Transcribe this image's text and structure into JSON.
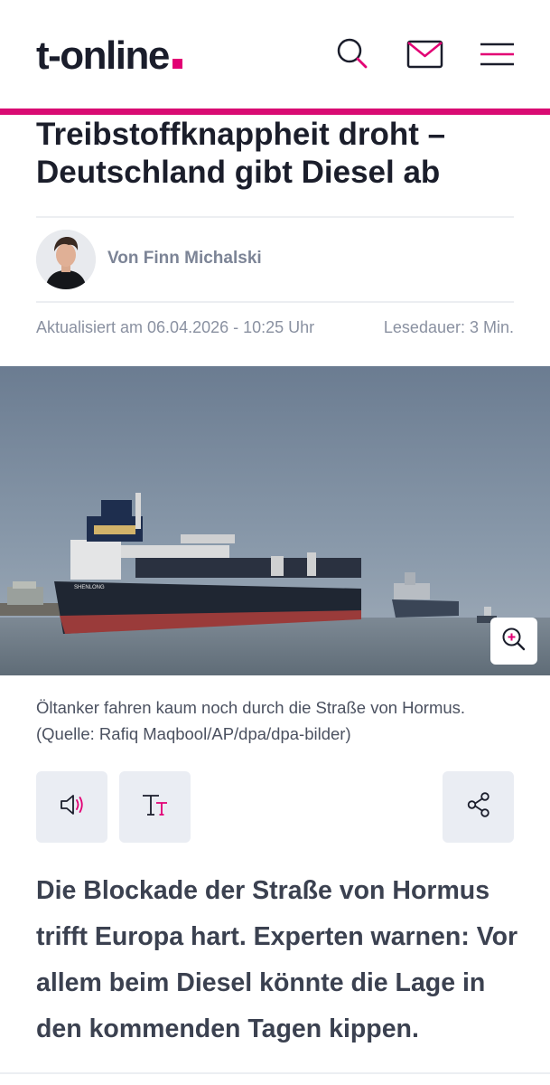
{
  "header": {
    "logo_text": "t-online",
    "accent_color": "#e20074",
    "icons": [
      "search-icon",
      "mail-icon",
      "menu-icon"
    ]
  },
  "article": {
    "title_line1": "Treibstoffknappheit droht –",
    "title_line2": "Deutschland gibt Diesel ab",
    "author": "Von Finn Michalski",
    "updated": "Aktualisiert am 06.04.2026 - 10:25 Uhr",
    "reading_time": "Lesedauer: 3 Min.",
    "image_caption_line1": "Öltanker fahren kaum noch durch die Straße von Hormus.",
    "image_caption_line2": "(Quelle: Rafiq Maqbool/AP/dpa/dpa-bilder)",
    "ship_name": "SHENLONG",
    "lead": "Die Blockade der Straße von Hormus trifft Europa hart. Experten warnen: Vor allem beim Diesel könnte die Lage in den kommenden Tagen kippen."
  },
  "actions": {
    "icons": [
      "speaker-icon",
      "text-size-icon",
      "share-icon"
    ]
  }
}
